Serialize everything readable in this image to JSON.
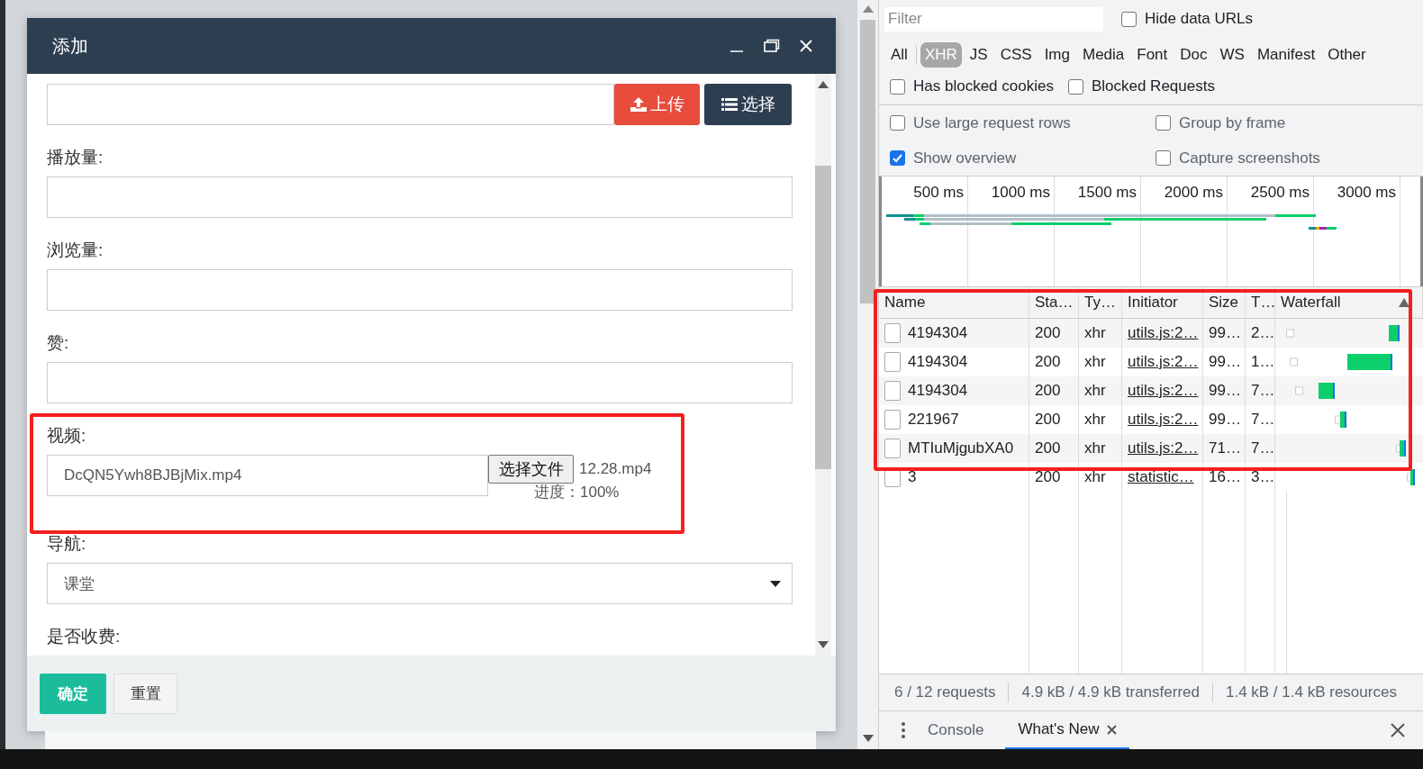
{
  "dialog": {
    "title": "添加",
    "fields": [
      {
        "kind": "upload",
        "buttons": [
          "上传",
          "选择"
        ]
      },
      {
        "kind": "text",
        "label": "播放量:"
      },
      {
        "kind": "text",
        "label": "浏览量:"
      },
      {
        "kind": "text",
        "label": "赞:"
      },
      {
        "kind": "file",
        "label": "视频:",
        "value": "DcQN5Ywh8BJBjMix.mp4",
        "button": "选择文件",
        "file_name": "12.28.mp4",
        "progress": "进度：100%"
      },
      {
        "kind": "select",
        "label": "导航:",
        "value": "课堂"
      },
      {
        "kind": "label",
        "label": "是否收费:"
      }
    ],
    "buttons": [
      {
        "label": "确定",
        "kind": "primary"
      },
      {
        "label": "重置",
        "kind": "default"
      }
    ]
  },
  "devtools": {
    "filter": {
      "placeholder": "Filter"
    },
    "hide_data_urls": {
      "label": "Hide data URLs",
      "checked": false
    },
    "type_filters": [
      {
        "label": "All",
        "selected": false
      },
      {
        "label": "XHR",
        "selected": true
      },
      {
        "label": "JS",
        "selected": false
      },
      {
        "label": "CSS",
        "selected": false
      },
      {
        "label": "Img",
        "selected": false
      },
      {
        "label": "Media",
        "selected": false
      },
      {
        "label": "Font",
        "selected": false
      },
      {
        "label": "Doc",
        "selected": false
      },
      {
        "label": "WS",
        "selected": false
      },
      {
        "label": "Manifest",
        "selected": false
      },
      {
        "label": "Other",
        "selected": false
      }
    ],
    "blocked_filters": [
      {
        "label": "Has blocked cookies",
        "checked": false
      },
      {
        "label": "Blocked Requests",
        "checked": false
      }
    ],
    "settings": [
      {
        "label": "Use large request rows",
        "checked": false
      },
      {
        "label": "Group by frame",
        "checked": false
      },
      {
        "label": "Show overview",
        "checked": true
      },
      {
        "label": "Capture screenshots",
        "checked": false
      }
    ],
    "overview": {
      "ticks": [
        "500 ms",
        "1000 ms",
        "1500 ms",
        "2000 ms",
        "2500 ms",
        "3000 ms"
      ]
    },
    "table": {
      "columns": [
        "Name",
        "Sta…",
        "Ty…",
        "Initiator",
        "Size",
        "T…",
        "Waterfall"
      ],
      "rows": [
        {
          "name": "4194304",
          "status": "200",
          "type": "xhr",
          "initiator": "utils.js:2…",
          "size": "99…",
          "time": "2…"
        },
        {
          "name": "4194304",
          "status": "200",
          "type": "xhr",
          "initiator": "utils.js:2…",
          "size": "99…",
          "time": "1…"
        },
        {
          "name": "4194304",
          "status": "200",
          "type": "xhr",
          "initiator": "utils.js:2…",
          "size": "99…",
          "time": "7…"
        },
        {
          "name": "221967",
          "status": "200",
          "type": "xhr",
          "initiator": "utils.js:2…",
          "size": "99…",
          "time": "7…"
        },
        {
          "name": "MTIuMjgubXA0",
          "status": "200",
          "type": "xhr",
          "initiator": "utils.js:2…",
          "size": "71…",
          "time": "7…"
        },
        {
          "name": "3",
          "status": "200",
          "type": "xhr",
          "initiator": "statistic…",
          "size": "16…",
          "time": "3…"
        }
      ]
    },
    "status_bar": [
      "6 / 12 requests",
      "4.9 kB / 4.9 kB transferred",
      "1.4 kB / 1.4 kB resources"
    ],
    "drawer_tabs": [
      {
        "label": "Console",
        "selected": false,
        "closable": false
      },
      {
        "label": "What's New",
        "selected": true,
        "closable": true
      }
    ]
  }
}
